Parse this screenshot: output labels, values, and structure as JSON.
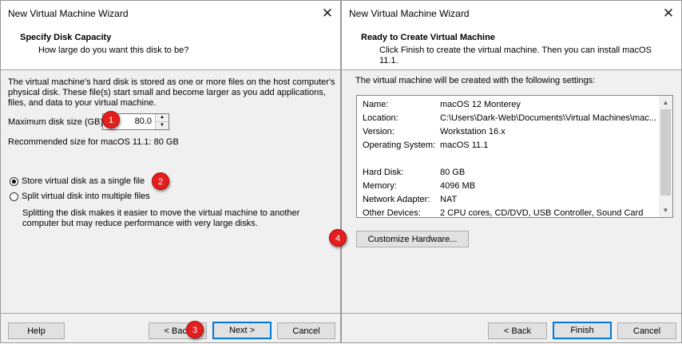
{
  "left": {
    "title": "New Virtual Machine Wizard",
    "header_title": "Specify Disk Capacity",
    "header_sub": "How large do you want this disk to be?",
    "description": "The virtual machine's hard disk is stored as one or more files on the host computer's physical disk. These file(s) start small and become larger as you add applications, files, and data to your virtual machine.",
    "max_disk_label": "Maximum disk size (GB):",
    "max_disk_value": "80.0",
    "recommended": "Recommended size for macOS 11.1: 80 GB",
    "radio_single": "Store virtual disk as a single file",
    "radio_multi": "Split virtual disk into multiple files",
    "split_note": "Splitting the disk makes it easier to move the virtual machine to another computer but may reduce performance with very large disks.",
    "help": "Help",
    "back": "< Back",
    "next": "Next >",
    "cancel": "Cancel",
    "selected_option": "single"
  },
  "right": {
    "title": "New Virtual Machine Wizard",
    "header_title": "Ready to Create Virtual Machine",
    "header_sub": "Click Finish to create the virtual machine. Then you can install macOS 11.1.",
    "intro": "The virtual machine will be created with the following settings:",
    "settings": [
      {
        "label": "Name:",
        "value": "macOS 12 Monterey"
      },
      {
        "label": "Location:",
        "value": "C:\\Users\\Dark-Web\\Documents\\Virtual Machines\\mac..."
      },
      {
        "label": "Version:",
        "value": "Workstation 16.x"
      },
      {
        "label": "Operating System:",
        "value": "macOS 11.1"
      },
      {
        "label": "",
        "value": ""
      },
      {
        "label": "Hard Disk:",
        "value": "80 GB"
      },
      {
        "label": "Memory:",
        "value": "4096 MB"
      },
      {
        "label": "Network Adapter:",
        "value": "NAT"
      },
      {
        "label": "Other Devices:",
        "value": "2 CPU cores, CD/DVD, USB Controller, Sound Card"
      }
    ],
    "customize": "Customize Hardware...",
    "back": "< Back",
    "finish": "Finish",
    "cancel": "Cancel"
  },
  "badges": [
    "1",
    "2",
    "3",
    "4"
  ],
  "colors": {
    "badge": "#e31e1e",
    "default_button_border": "#0078d7"
  }
}
